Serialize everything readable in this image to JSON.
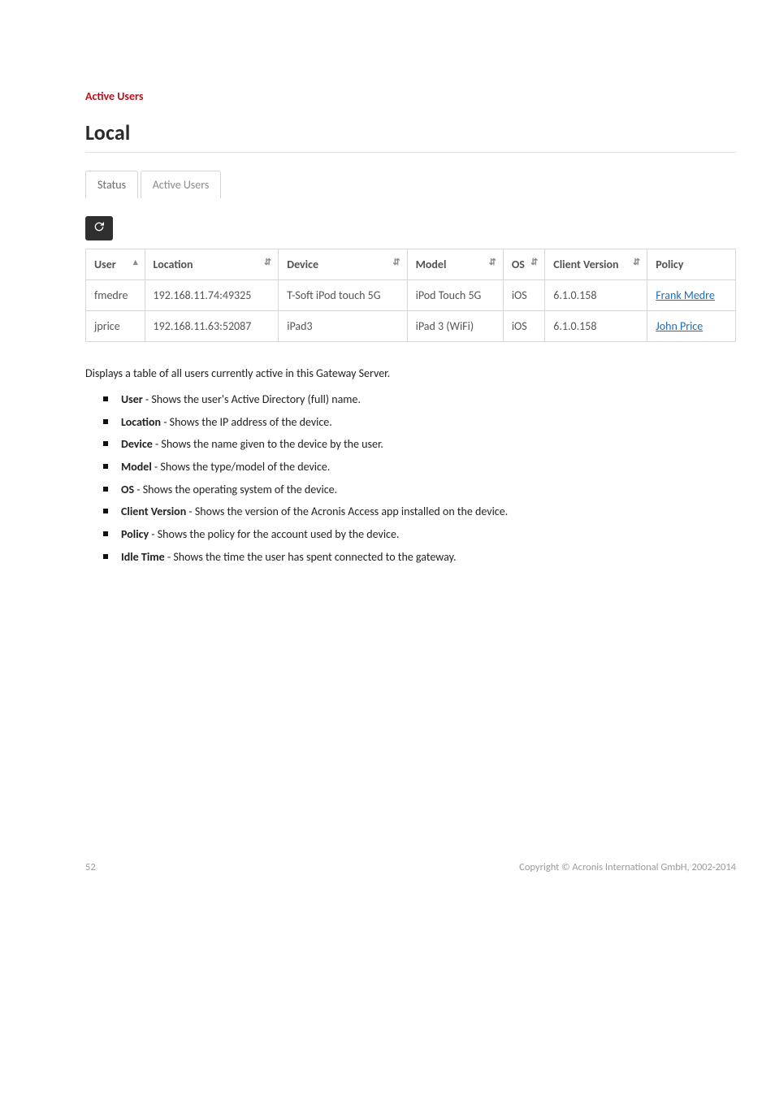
{
  "section_heading": "Active Users",
  "panel_title": "Local",
  "tabs": {
    "status_label": "Status",
    "active_users_label": "Active Users"
  },
  "table": {
    "headers": {
      "user": "User",
      "location": "Location",
      "device": "Device",
      "model": "Model",
      "os": "OS",
      "client_version": "Client Version",
      "policy": "Policy"
    },
    "sort_asc_glyph": "▴",
    "sort_both_glyph": "⇵",
    "rows": [
      {
        "user": "fmedre",
        "location": "192.168.11.74:49325",
        "device": "T-Soft iPod touch 5G",
        "model": "iPod Touch 5G",
        "os": "iOS",
        "client_version": "6.1.0.158",
        "policy": "Frank Medre"
      },
      {
        "user": "jprice",
        "location": "192.168.11.63:52087",
        "device": "iPad3",
        "model": "iPad 3 (WiFi)",
        "os": "iOS",
        "client_version": "6.1.0.158",
        "policy": "John Price"
      }
    ]
  },
  "description": "Displays a table of all users currently active in this Gateway Server.",
  "fields": [
    {
      "term": "User",
      "desc": " - Shows the user's Active Directory (full) name."
    },
    {
      "term": "Location",
      "desc": " - Shows the IP address of the device."
    },
    {
      "term": "Device",
      "desc": " - Shows the name given to the device by the user."
    },
    {
      "term": "Model",
      "desc": " - Shows the type/model of the device."
    },
    {
      "term": "OS",
      "desc": " - Shows the operating system of the device."
    },
    {
      "term": "Client Version",
      "desc": " - Shows the version of the Acronis Access app installed on the device."
    },
    {
      "term": "Policy",
      "desc": " - Shows the policy for the account used by the device."
    },
    {
      "term": "Idle Time",
      "desc": " - Shows the time the user has spent connected to the gateway."
    }
  ],
  "footer": {
    "page": "52",
    "copyright": "Copyright © Acronis International GmbH, 2002-2014"
  }
}
